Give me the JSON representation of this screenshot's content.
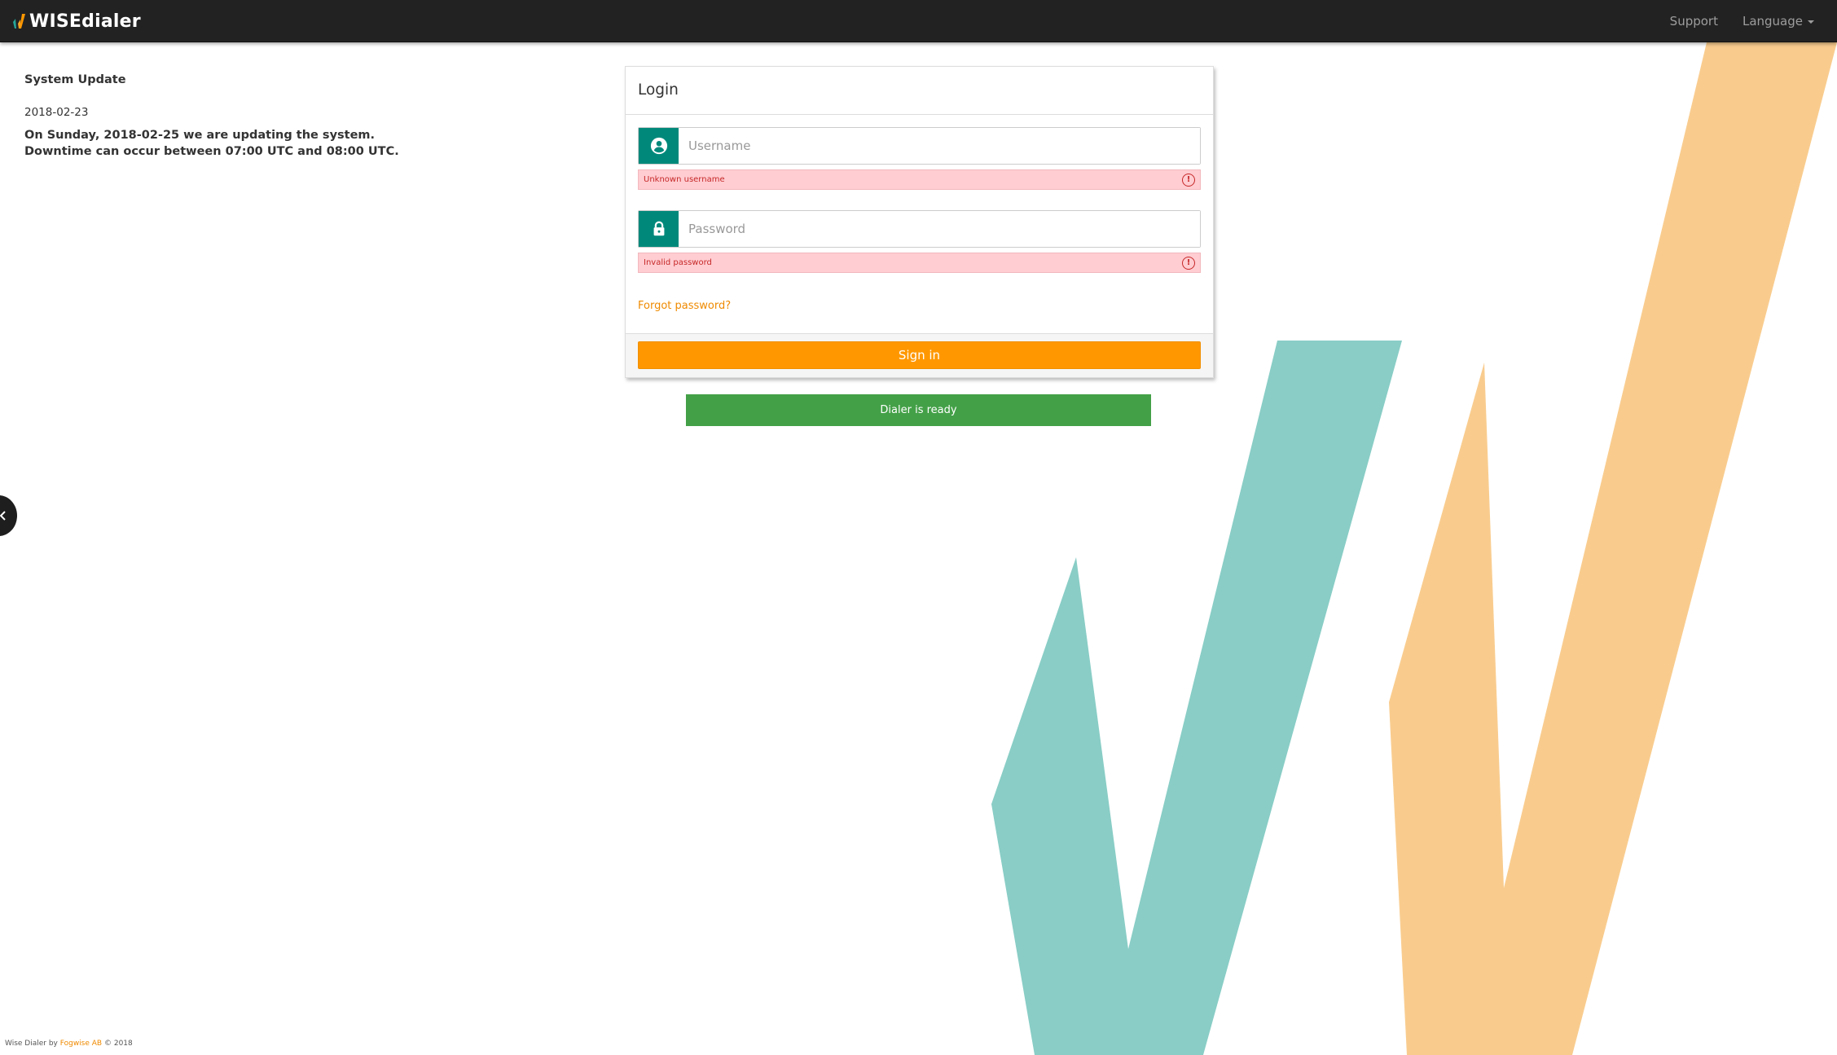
{
  "brand": {
    "name": "WISEdialer"
  },
  "nav": {
    "support": "Support",
    "language": "Language"
  },
  "news": {
    "title": "System Update",
    "date": "2018-02-23",
    "body": "On Sunday, 2018-02-25 we are updating the system. Downtime can occur between 07:00 UTC and 08:00 UTC."
  },
  "login": {
    "title": "Login",
    "username": {
      "placeholder": "Username",
      "value": "",
      "error": "Unknown username"
    },
    "password": {
      "placeholder": "Password",
      "value": "",
      "error": "Invalid password"
    },
    "forgot": "Forgot password?",
    "submit": "Sign in"
  },
  "status": "Dialer is ready",
  "footer": {
    "prefix": "Wise Dialer by",
    "company": "Fogwise AB",
    "suffix": "© 2018"
  },
  "colors": {
    "accent": "#ff9800",
    "teal": "#00897b",
    "success": "#43a047",
    "error_bg": "#ffcdd2",
    "shape_teal": "#89cdc6",
    "shape_orange": "#f9cc8e"
  },
  "icons": {
    "user": "user-circle-icon",
    "password": "lock-icon",
    "alert": "alert-circle-icon",
    "toggle": "chevron-left-icon"
  }
}
